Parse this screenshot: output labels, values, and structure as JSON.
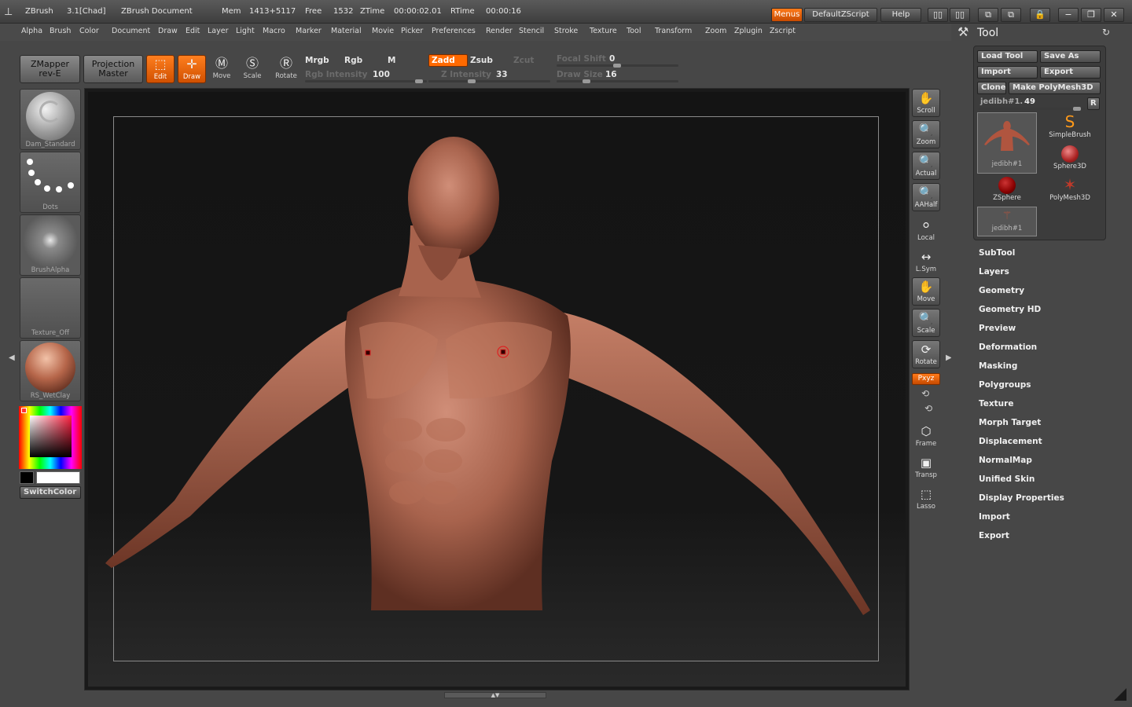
{
  "titlebar": {
    "app": "ZBrush",
    "version": "3.1[Chad]",
    "document": "ZBrush Document",
    "mem_label": "Mem",
    "mem": "1413+5117",
    "free_label": "Free",
    "free": "1532",
    "ztime_label": "ZTime",
    "ztime": "00:00:02.01",
    "rtime_label": "RTime",
    "rtime": "00:00:16",
    "menus_btn": "Menus",
    "script_btn": "DefaultZScript",
    "help_btn": "Help"
  },
  "menubar": [
    "Alpha",
    "Brush",
    "Color",
    "Document",
    "Draw",
    "Edit",
    "Layer",
    "Light",
    "Macro",
    "Marker",
    "Material",
    "Movie",
    "Picker",
    "Preferences",
    "Render",
    "Stencil",
    "Stroke",
    "Texture",
    "Tool",
    "Transform",
    "Zoom",
    "Zplugin",
    "Zscript"
  ],
  "toolbar": {
    "zmapper_line1": "ZMapper",
    "zmapper_line2": "rev-E",
    "projection_line1": "Projection",
    "projection_line2": "Master",
    "edit": "Edit",
    "draw": "Draw",
    "move": "Move",
    "scale": "Scale",
    "rotate": "Rotate",
    "mrgb": "Mrgb",
    "rgb": "Rgb",
    "m": "M",
    "rgb_intensity_label": "Rgb Intensity",
    "rgb_intensity": "100",
    "zadd": "Zadd",
    "zsub": "Zsub",
    "zcut": "Zcut",
    "z_intensity_label": "Z Intensity",
    "z_intensity": "33",
    "focal_shift_label": "Focal Shift",
    "focal_shift": "0",
    "draw_size_label": "Draw Size",
    "draw_size": "16"
  },
  "left_shelf": {
    "brush": "Dam_Standard",
    "stroke": "Dots",
    "alpha": "BrushAlpha",
    "texture": "Texture_Off",
    "material": "RS_WetClay",
    "switch_color": "SwitchColor"
  },
  "right_shelf": [
    "Scroll",
    "Zoom",
    "Actual",
    "AAHalf",
    "Local",
    "L.Sym",
    "Move",
    "Scale",
    "Rotate",
    "Frame",
    "Transp",
    "Lasso"
  ],
  "right_shelf_xyz": "Pxyz",
  "tool_panel": {
    "title": "Tool",
    "load_tool": "Load Tool",
    "save_as": "Save As",
    "import": "Import",
    "export": "Export",
    "clone": "Clone",
    "make_polymesh": "Make PolyMesh3D",
    "current_tool_label": "jedibh#1.",
    "current_tool_value": "49",
    "r_btn": "R",
    "thumbs": [
      "jedibh#1",
      "SimpleBrush",
      "Sphere3D",
      "ZSphere",
      "PolyMesh3D",
      "jedibh#1"
    ],
    "menu_items": [
      "SubTool",
      "Layers",
      "Geometry",
      "Geometry HD",
      "Preview",
      "Deformation",
      "Masking",
      "Polygroups",
      "Texture",
      "Morph Target",
      "Displacement",
      "NormalMap",
      "Unified Skin",
      "Display Properties",
      "Import",
      "Export"
    ]
  },
  "colors": {
    "accent": "#ff6a00",
    "panel": "#474747",
    "canvas": "#141414",
    "clay": "#b07060"
  }
}
